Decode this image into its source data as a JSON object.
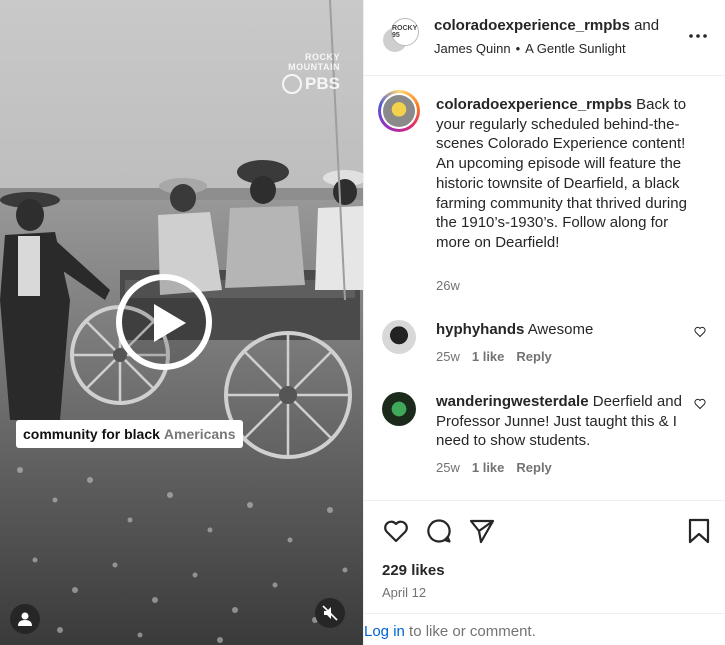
{
  "media": {
    "watermark": {
      "line1": "ROCKY",
      "line2": "MOUNTAIN",
      "line3": "PBS"
    },
    "caption_dark": "community for black",
    "caption_light": "Americans",
    "play_icon": "play-icon",
    "user_icon": "user-icon",
    "mute_icon": "muted-speaker-icon"
  },
  "header": {
    "username": "coloradoexperience_rmpbs",
    "and_text": "and",
    "collab_truncated": "",
    "audio_artist": "James Quinn",
    "separator": "•",
    "audio_track": "A Gentle Sunlight",
    "badge_text": "ROCKY 95",
    "more_icon": "more-horizontal-icon"
  },
  "caption": {
    "username": "coloradoexperience_rmpbs",
    "text": "Back to your regularly scheduled behind-the-scenes Colorado Experience content! An upcoming episode will feature the historic townsite of Dearfield, a black farming community that thrived during the 1910’s-1930’s. Follow along for more on Dearfield!",
    "time": "26w"
  },
  "comments": [
    {
      "username": "hyphyhands",
      "text": "Awesome",
      "time": "25w",
      "likes": "1 like",
      "reply": "Reply"
    },
    {
      "username": "wanderingwesterdale",
      "text": "Deerfield and Professor Junne! Just taught this & I need to show students.",
      "time": "25w",
      "likes": "1 like",
      "reply": "Reply"
    }
  ],
  "actions": {
    "icons": [
      "heart-icon",
      "comment-icon",
      "share-icon",
      "bookmark-icon"
    ],
    "likes": "229 likes",
    "date": "April 12"
  },
  "login": {
    "link": "Log in",
    "rest": " to like or comment."
  },
  "colors": {
    "link": "#0064d0",
    "muted": "#737373",
    "text": "#262626",
    "border": "#efefef"
  }
}
